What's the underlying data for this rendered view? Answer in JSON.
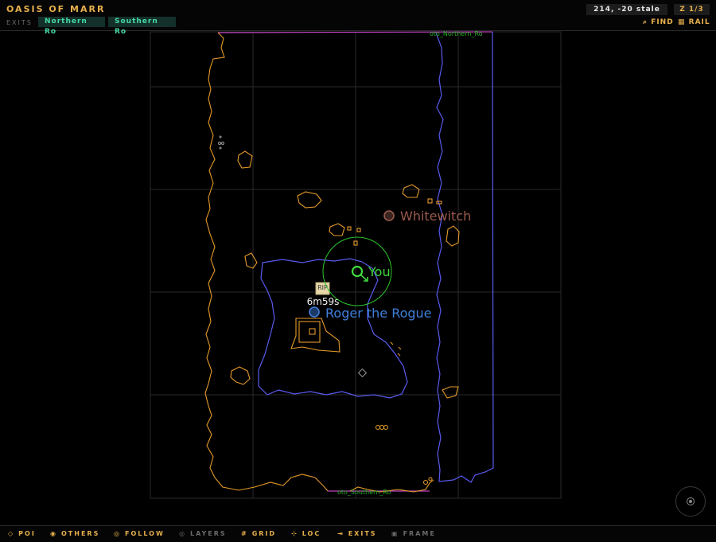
{
  "header": {
    "zone_title": "OASIS OF MARR",
    "exits_label": "EXITS",
    "exits": [
      "Northern Ro",
      "Southern Ro"
    ],
    "coords": "214, -20  stale",
    "zlevel": "Z 1/3",
    "find_label": "FIND",
    "rail_label": "RAIL"
  },
  "map": {
    "labels": {
      "north_exit": "oto_Northern_Ro",
      "south_exit": "oto_Southern_Ro",
      "rip": "RIP",
      "corpse_timer": "6m59s"
    },
    "players": [
      {
        "name": "You",
        "color": "#3fd93f"
      },
      {
        "name": "Whitewitch",
        "color": "#9a5a4c"
      },
      {
        "name": "Roger the Rogue",
        "color": "#3f7fd9"
      }
    ],
    "colors": {
      "wall": "#e49a2a",
      "water": "#5a5af0",
      "zone_line": "#c040c0",
      "grid": "#2a2a2a"
    }
  },
  "toolbar": {
    "items": [
      {
        "icon": "◇",
        "label": "POI",
        "active": true
      },
      {
        "icon": "◉",
        "label": "OTHERS",
        "active": true
      },
      {
        "icon": "◎",
        "label": "FOLLOW",
        "active": true
      },
      {
        "icon": "◎",
        "label": "LAYERS",
        "active": false
      },
      {
        "icon": "#",
        "label": "GRID",
        "active": true
      },
      {
        "icon": "⊹",
        "label": "LOC",
        "active": true
      },
      {
        "icon": "⇥",
        "label": "EXITS",
        "active": true
      },
      {
        "icon": "▣",
        "label": "FRAME",
        "active": false
      }
    ]
  }
}
